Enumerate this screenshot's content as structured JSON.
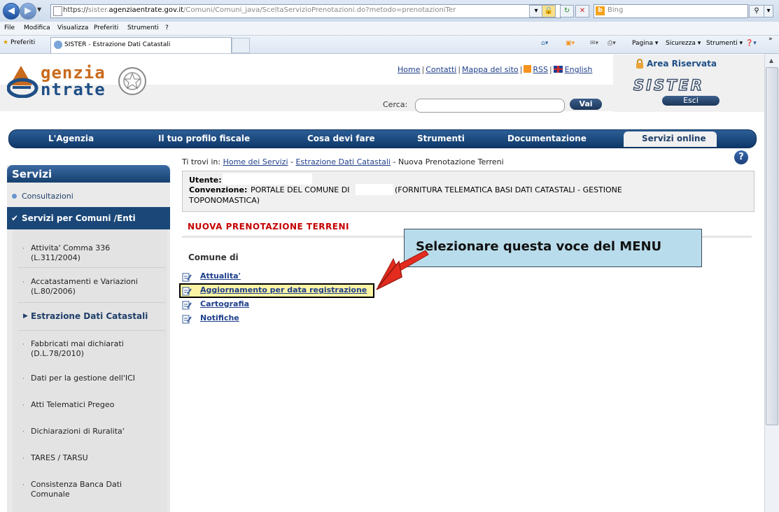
{
  "browser": {
    "address_scheme": "https://",
    "address_host_pre": "sister.",
    "address_host": "agenziaentrate.gov.it",
    "address_path": "/Comuni/Comuni_java/SceltaServizioPrenotazioni.do?metodo=prenotazioniTer",
    "search_placeholder": "Bing",
    "bing_logo": "b",
    "menu": [
      "File",
      "Modifica",
      "Visualizza",
      "Preferiti",
      "Strumenti",
      "?"
    ],
    "favorites_label": "Preferiti",
    "tab_title": "SISTER - Estrazione Dati Catastali",
    "commands": [
      "Pagina ▾",
      "Sicurezza ▾",
      "Strumenti ▾"
    ],
    "overflow": "»"
  },
  "header": {
    "logo_line1": "genzia",
    "logo_line2": "ntrate",
    "links": [
      "Home",
      "Contatti",
      "Mappa del sito",
      "RSS",
      "English"
    ],
    "search_label": "Cerca:",
    "search_button": "Vai",
    "area_label": "Area Riservata",
    "sister_logo": "SISTER",
    "logout_button": "Esci"
  },
  "nav": {
    "items": [
      "L'Agenzia",
      "Il tuo profilo fiscale",
      "Cosa devi fare",
      "Strumenti",
      "Documentazione"
    ],
    "active": "Servizi online"
  },
  "sidebar": {
    "title": "Servizi",
    "consultazioni": "Consultazioni",
    "comuni": "Servizi per Comuni /Enti",
    "items": [
      "Attivita' Comma 336 (L.311/2004)",
      "Accatastamenti e Variazioni (L.80/2006)",
      "Estrazione Dati Catastali",
      "Fabbricati mai dichiarati (D.L.78/2010)",
      "Dati per la gestione dell'ICI",
      "Atti Telematici Pregeo",
      "Dichiarazioni di Ruralita'",
      "TARES / TARSU",
      "Consistenza Banca Dati Comunale"
    ]
  },
  "main": {
    "breadcrumb_prefix": "Ti trovi in:",
    "breadcrumb": [
      "Home dei Servizi",
      "Estrazione Dati Catastali",
      "Nuova Prenotazione Terreni"
    ],
    "help": "?",
    "utente_label": "Utente:",
    "convenzione_label": "Convenzione:",
    "convenzione_part1": "PORTALE DEL COMUNE DI",
    "convenzione_part2": "(FORNITURA TELEMATICA BASI DATI CATASTALI - GESTIONE",
    "convenzione_part3": "TOPONOMASTICA)",
    "section_title": "NUOVA PRENOTAZIONE TERRENI",
    "comune_label": "Comune di",
    "links": [
      "Attualita'",
      "Aggiornamento per data registrazione",
      "Cartografia",
      "Notifiche"
    ]
  },
  "callout": {
    "text": "Selezionare questa  voce del MENU",
    "color": "#b8dceb"
  },
  "colors": {
    "brand_blue": "#1f4f86",
    "brand_orange": "#c96a1c",
    "nav_blue": "#0f3869",
    "section_red": "#c40000",
    "highlight_yellow": "#fbf4a4"
  }
}
